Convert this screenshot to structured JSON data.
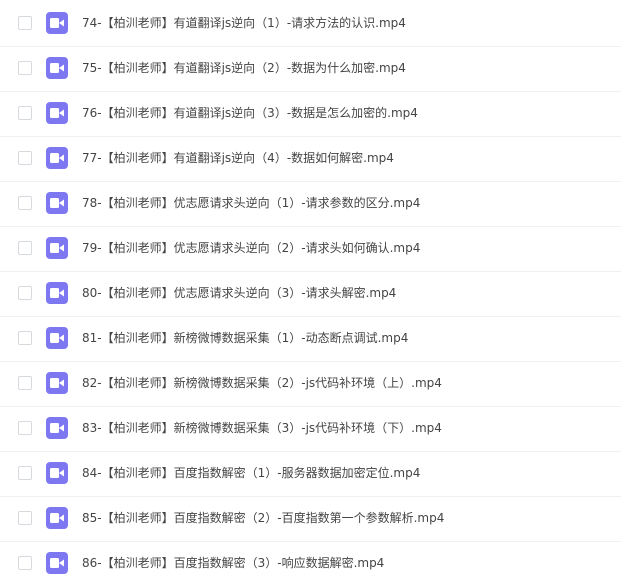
{
  "files": [
    {
      "name": "74-【柏汌老师】有道翻译js逆向（1）-请求方法的认识.mp4",
      "icon": "video-file-icon"
    },
    {
      "name": "75-【柏汌老师】有道翻译js逆向（2）-数据为什么加密.mp4",
      "icon": "video-file-icon"
    },
    {
      "name": "76-【柏汌老师】有道翻译js逆向（3）-数据是怎么加密的.mp4",
      "icon": "video-file-icon"
    },
    {
      "name": "77-【柏汌老师】有道翻译js逆向（4）-数据如何解密.mp4",
      "icon": "video-file-icon"
    },
    {
      "name": "78-【柏汌老师】优志愿请求头逆向（1）-请求参数的区分.mp4",
      "icon": "video-file-icon"
    },
    {
      "name": "79-【柏汌老师】优志愿请求头逆向（2）-请求头如何确认.mp4",
      "icon": "video-file-icon"
    },
    {
      "name": "80-【柏汌老师】优志愿请求头逆向（3）-请求头解密.mp4",
      "icon": "video-file-icon"
    },
    {
      "name": "81-【柏汌老师】新榜微博数据采集（1）-动态断点调试.mp4",
      "icon": "video-file-icon"
    },
    {
      "name": "82-【柏汌老师】新榜微博数据采集（2）-js代码补环境（上）.mp4",
      "icon": "video-file-icon"
    },
    {
      "name": "83-【柏汌老师】新榜微博数据采集（3）-js代码补环境（下）.mp4",
      "icon": "video-file-icon"
    },
    {
      "name": "84-【柏汌老师】百度指数解密（1）-服务器数据加密定位.mp4",
      "icon": "video-file-icon"
    },
    {
      "name": "85-【柏汌老师】百度指数解密（2）-百度指数第一个参数解析.mp4",
      "icon": "video-file-icon"
    },
    {
      "name": "86-【柏汌老师】百度指数解密（3）-响应数据解密.mp4",
      "icon": "video-file-icon"
    }
  ],
  "colors": {
    "icon_bg": "#7e77f2",
    "text": "#444444",
    "row_border": "#eef0f4",
    "checkbox_border": "#d6d9de"
  }
}
